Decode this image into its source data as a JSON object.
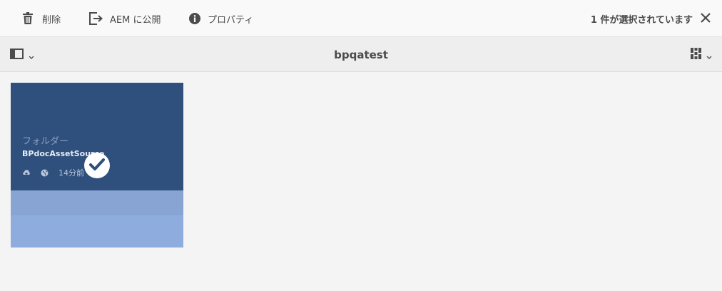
{
  "action_bar": {
    "delete_label": "削除",
    "publish_label": "AEM に公開",
    "properties_label": "プロパティ",
    "selection_text": "1 件が選択されています"
  },
  "header": {
    "title": "bpqatest"
  },
  "card": {
    "type_label": "フォルダー",
    "title": "BPdocAssetSource",
    "modified": "14分前"
  },
  "icons": {
    "delete": "trash-icon",
    "publish": "publish-icon",
    "properties": "info-icon",
    "close": "close-icon",
    "rail": "rail-toggle-icon",
    "view": "card-view-icon",
    "check": "check-icon"
  },
  "colors": {
    "card_top": "#2f4f7c",
    "card_mid": "#88a4d3",
    "card_bottom": "#8eadde",
    "check_badge": "#ffffff"
  }
}
